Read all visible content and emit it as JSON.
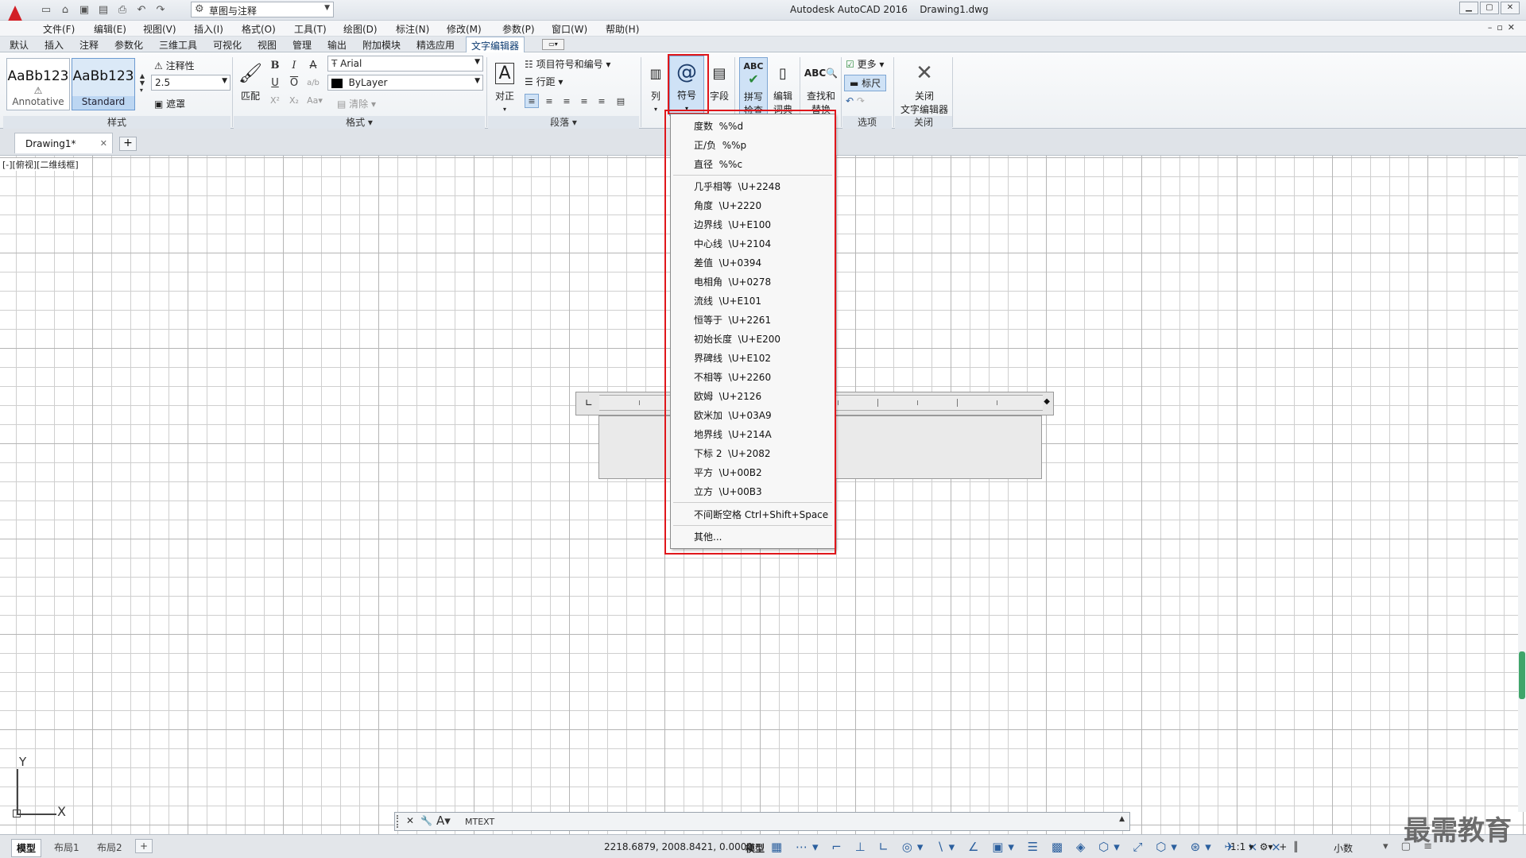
{
  "app": {
    "title": "Autodesk AutoCAD 2016",
    "file": "Drawing1.dwg",
    "workspace": "草图与注释"
  },
  "menu": [
    "文件(F)",
    "编辑(E)",
    "视图(V)",
    "插入(I)",
    "格式(O)",
    "工具(T)",
    "绘图(D)",
    "标注(N)",
    "修改(M)",
    "参数(P)",
    "窗口(W)",
    "帮助(H)"
  ],
  "ribbon_tabs": [
    "默认",
    "插入",
    "注释",
    "参数化",
    "三维工具",
    "可视化",
    "视图",
    "管理",
    "输出",
    "附加模块",
    "精选应用",
    "文字编辑器"
  ],
  "active_tab": "文字编辑器",
  "style_panel": {
    "title": "样式",
    "style1_sample": "AaBb123",
    "style1_name": "Annotative",
    "style2_sample": "AaBb123",
    "style2_name": "Standard",
    "annotative_label": "注释性",
    "height_value": "2.5",
    "mask_label": "遮罩"
  },
  "format_panel": {
    "title": "格式",
    "match_label": "匹配",
    "font_value": "Arial",
    "color_value": "ByLayer",
    "clear_label": "清除"
  },
  "paragraph_panel": {
    "title": "段落",
    "justify_label": "对正",
    "bullets_label": "项目符号和编号",
    "line_spacing_label": "行距"
  },
  "insert_panel": {
    "columns_label": "列",
    "symbol_label": "符号",
    "field_label": "字段"
  },
  "spell_panel": {
    "spell_label_1": "拼写",
    "spell_label_2": "检查",
    "dict_label_1": "编辑",
    "dict_label_2": "词典"
  },
  "tools_panel": {
    "find_label_1": "查找和",
    "find_label_2": "替换"
  },
  "options_panel": {
    "title": "选项",
    "more_label": "更多",
    "ruler_label": "标尺"
  },
  "close_panel": {
    "title": "关闭",
    "close_label_1": "关闭",
    "close_label_2": "文字编辑器"
  },
  "document_tab": "Drawing1*",
  "viewport_label": "[-][俯视][二维线框]",
  "ucs": {
    "y": "Y",
    "x": "X"
  },
  "symbol_menu": {
    "group1": [
      {
        "name": "度数",
        "code": "%%d"
      },
      {
        "name": "正/负",
        "code": "%%p"
      },
      {
        "name": "直径",
        "code": "%%c"
      }
    ],
    "group2": [
      {
        "name": "几乎相等",
        "code": "\\U+2248"
      },
      {
        "name": "角度",
        "code": "\\U+2220"
      },
      {
        "name": "边界线",
        "code": "\\U+E100"
      },
      {
        "name": "中心线",
        "code": "\\U+2104"
      },
      {
        "name": "差值",
        "code": "\\U+0394"
      },
      {
        "name": "电相角",
        "code": "\\U+0278"
      },
      {
        "name": "流线",
        "code": "\\U+E101"
      },
      {
        "name": "恒等于",
        "code": "\\U+2261"
      },
      {
        "name": "初始长度",
        "code": "\\U+E200"
      },
      {
        "name": "界碑线",
        "code": "\\U+E102"
      },
      {
        "name": "不相等",
        "code": "\\U+2260"
      },
      {
        "name": "欧姆",
        "code": "\\U+2126"
      },
      {
        "name": "欧米加",
        "code": "\\U+03A9"
      },
      {
        "name": "地界线",
        "code": "\\U+214A"
      },
      {
        "name": "下标 2",
        "code": "\\U+2082"
      },
      {
        "name": "平方",
        "code": "\\U+00B2"
      },
      {
        "name": "立方",
        "code": "\\U+00B3"
      }
    ],
    "nbsp": {
      "name": "不间断空格",
      "code": "Ctrl+Shift+Space"
    },
    "other": "其他..."
  },
  "command_line": {
    "prompt": "MTEXT"
  },
  "layout_tabs": [
    "模型",
    "布局1",
    "布局2"
  ],
  "status": {
    "coords": "2218.6879, 2008.8421, 0.0000",
    "model_label": "模型",
    "scale": "1:1",
    "units": "小数"
  },
  "watermark": "最需教育",
  "colors": {
    "highlight_box": "#e0161b",
    "accent": "#2b5f9e",
    "logo": "#d21f26"
  }
}
